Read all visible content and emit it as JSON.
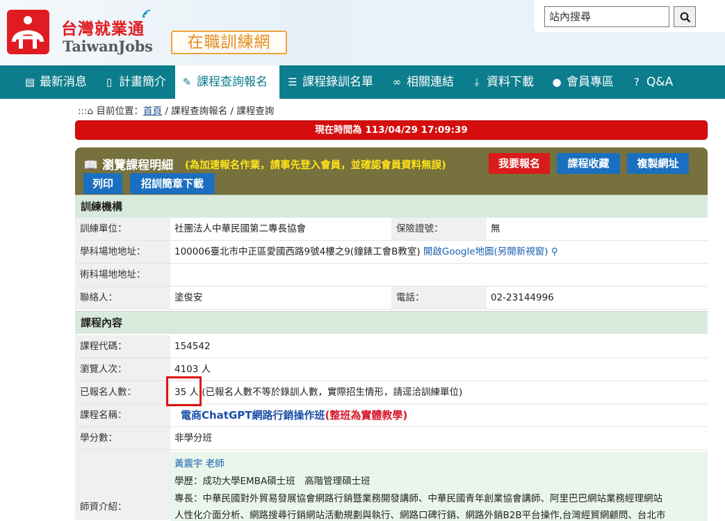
{
  "header": {
    "brand_cn": "台灣就業通",
    "brand_en": "TaiwanJobs",
    "site_name": "在職訓練網",
    "search_placeholder": "站內搜尋"
  },
  "nav": [
    {
      "label": "最新消息",
      "icon": "newspaper-icon"
    },
    {
      "label": "計畫簡介",
      "icon": "clipboard-icon"
    },
    {
      "label": "課程查詢報名",
      "icon": "pencil-icon",
      "active": true
    },
    {
      "label": "課程錄訓名單",
      "icon": "list-icon"
    },
    {
      "label": "相關連結",
      "icon": "link-icon"
    },
    {
      "label": "資料下載",
      "icon": "download-icon"
    },
    {
      "label": "會員專區",
      "icon": "user-icon"
    },
    {
      "label": "Q&A",
      "icon": "question-icon"
    }
  ],
  "breadcrumb": {
    "prefix": ":::",
    "label": "目前位置：",
    "home": "首頁",
    "path": " / 課程查詢報名 / 課程查詢"
  },
  "timebar": "現在時間為 113/04/29 17:09:39",
  "panel": {
    "title": "瀏覽課程明細",
    "note": "(為加速報名作業，請事先登入會員，並確認會員資料無誤)",
    "buttons": {
      "enroll": "我要報名",
      "favorite": "課程收藏",
      "copy_url": "複製網址",
      "print": "列印",
      "brochure": "招訓簡章下載"
    }
  },
  "sections": {
    "org": "訓練機構",
    "content": "課程內容"
  },
  "org": {
    "unit_label": "訓練單位：",
    "unit_value": "社團法人中華民國第二專長協會",
    "insurance_label": "保險證號：",
    "insurance_value": "無",
    "theory_addr_label": "學科場地地址：",
    "theory_addr_value": "100006臺北市中正區愛國西路9號4樓之9(鐘錶工會B教室)",
    "map_link": "開啟Google地圖(另開新視窗)",
    "practice_addr_label": "術科場地地址：",
    "practice_addr_value": "",
    "contact_label": "聯絡人：",
    "contact_value": "塗俊安",
    "phone_label": "電話：",
    "phone_value": "02-23144996"
  },
  "course": {
    "code_label": "課程代碼：",
    "code_value": "154542",
    "views_label": "瀏覽人次：",
    "views_value": "4103 人",
    "enrolled_label": "已報名人數：",
    "enrolled_value": "35 人",
    "enrolled_note": "(已報名人數不等於錄訓人數，實際招生情形，請逕洽訓練單位)",
    "name_label": "課程名稱：",
    "name_value": "電商ChatGPT網路行銷操作班",
    "name_note": "(整班為實體教學)",
    "credit_label": "學分數：",
    "credit_value": "非學分班",
    "teacher_label": "師資介紹：",
    "teacher_name": "黃震宇 老師",
    "teacher_edu": "學歷：成功大學EMBA碩士班　高階管理碩士班",
    "teacher_spec1": "專長：中華民國對外貿易發展協會網路行銷暨業務開發講師、中華民國青年創業協會講師、阿里巴巴網站業務經理網站",
    "teacher_spec2": "人性化介面分析、網路搜尋行銷網站活動規劃與執行、網路口碑行銷、網路外銷B2B平台操作,台灣經貿網顧問、台北市"
  }
}
